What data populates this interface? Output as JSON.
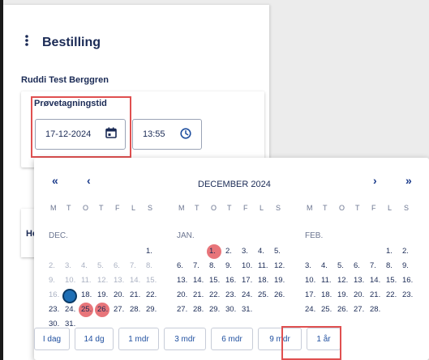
{
  "header": {
    "menu_icon": "more-vert",
    "title": "Bestilling"
  },
  "patient_name": "Ruddi Test Berggren",
  "sample": {
    "label": "Prøvetagningstid",
    "date_value": "17-12-2024",
    "time_value": "13:55",
    "date_icon": "calendar-icon",
    "time_icon": "clock-icon"
  },
  "second_card_label": "He",
  "calendar": {
    "nav": {
      "prev_year": "«",
      "prev_month": "‹",
      "next_month": "›",
      "next_year": "»"
    },
    "title": "DECEMBER 2024",
    "weekdays": [
      "M",
      "T",
      "O",
      "T",
      "F",
      "L",
      "S"
    ],
    "months": [
      {
        "name": "DEC.",
        "rows": [
          [
            [
              "",
              "",
              ""
            ],
            [
              "",
              "",
              ""
            ],
            [
              "",
              "",
              ""
            ],
            [
              "",
              "",
              ""
            ],
            [
              "",
              "",
              ""
            ],
            [
              "",
              "",
              ""
            ],
            [
              "1.",
              "",
              ""
            ]
          ],
          [
            [
              "2.",
              "m",
              ""
            ],
            [
              "3.",
              "m",
              ""
            ],
            [
              "4.",
              "m",
              ""
            ],
            [
              "5.",
              "m",
              ""
            ],
            [
              "6.",
              "m",
              ""
            ],
            [
              "7.",
              "m",
              ""
            ],
            [
              "8.",
              "m",
              ""
            ]
          ],
          [
            [
              "9.",
              "m",
              ""
            ],
            [
              "10.",
              "m",
              ""
            ],
            [
              "11.",
              "m",
              ""
            ],
            [
              "12.",
              "m",
              ""
            ],
            [
              "13.",
              "m",
              ""
            ],
            [
              "14.",
              "m",
              ""
            ],
            [
              "15.",
              "m",
              ""
            ]
          ],
          [
            [
              "16.",
              "m",
              ""
            ],
            [
              "17.",
              "",
              "today"
            ],
            [
              "18.",
              "",
              ""
            ],
            [
              "19.",
              "",
              ""
            ],
            [
              "20.",
              "",
              ""
            ],
            [
              "21.",
              "",
              ""
            ],
            [
              "22.",
              "",
              ""
            ]
          ],
          [
            [
              "23.",
              "",
              ""
            ],
            [
              "24.",
              "",
              ""
            ],
            [
              "25.",
              "",
              "hl"
            ],
            [
              "26.",
              "",
              "hl"
            ],
            [
              "27.",
              "",
              ""
            ],
            [
              "28.",
              "",
              ""
            ],
            [
              "29.",
              "",
              ""
            ]
          ],
          [
            [
              "30.",
              "",
              ""
            ],
            [
              "31.",
              "",
              ""
            ],
            [
              "",
              "",
              ""
            ],
            [
              "",
              "",
              ""
            ],
            [
              "",
              "",
              ""
            ],
            [
              "",
              "",
              ""
            ],
            [
              "",
              "",
              ""
            ]
          ]
        ]
      },
      {
        "name": "JAN.",
        "rows": [
          [
            [
              "",
              "",
              ""
            ],
            [
              "",
              "",
              ""
            ],
            [
              "1.",
              "",
              "hl"
            ],
            [
              "2.",
              "",
              ""
            ],
            [
              "3.",
              "",
              ""
            ],
            [
              "4.",
              "",
              ""
            ],
            [
              "5.",
              "",
              ""
            ]
          ],
          [
            [
              "6.",
              "",
              ""
            ],
            [
              "7.",
              "",
              ""
            ],
            [
              "8.",
              "",
              ""
            ],
            [
              "9.",
              "",
              ""
            ],
            [
              "10.",
              "",
              ""
            ],
            [
              "11.",
              "",
              ""
            ],
            [
              "12.",
              "",
              ""
            ]
          ],
          [
            [
              "13.",
              "",
              ""
            ],
            [
              "14.",
              "",
              ""
            ],
            [
              "15.",
              "",
              ""
            ],
            [
              "16.",
              "",
              ""
            ],
            [
              "17.",
              "",
              ""
            ],
            [
              "18.",
              "",
              ""
            ],
            [
              "19.",
              "",
              ""
            ]
          ],
          [
            [
              "20.",
              "",
              ""
            ],
            [
              "21.",
              "",
              ""
            ],
            [
              "22.",
              "",
              ""
            ],
            [
              "23.",
              "",
              ""
            ],
            [
              "24.",
              "",
              ""
            ],
            [
              "25.",
              "",
              ""
            ],
            [
              "26.",
              "",
              ""
            ]
          ],
          [
            [
              "27.",
              "",
              ""
            ],
            [
              "28.",
              "",
              ""
            ],
            [
              "29.",
              "",
              ""
            ],
            [
              "30.",
              "",
              ""
            ],
            [
              "31.",
              "",
              ""
            ],
            [
              "",
              "",
              ""
            ],
            [
              "",
              "",
              ""
            ]
          ]
        ]
      },
      {
        "name": "FEB.",
        "rows": [
          [
            [
              "",
              "",
              ""
            ],
            [
              "",
              "",
              ""
            ],
            [
              "",
              "",
              ""
            ],
            [
              "",
              "",
              ""
            ],
            [
              "",
              "",
              ""
            ],
            [
              "1.",
              "",
              ""
            ],
            [
              "2.",
              "",
              ""
            ]
          ],
          [
            [
              "3.",
              "",
              ""
            ],
            [
              "4.",
              "",
              ""
            ],
            [
              "5.",
              "",
              ""
            ],
            [
              "6.",
              "",
              ""
            ],
            [
              "7.",
              "",
              ""
            ],
            [
              "8.",
              "",
              ""
            ],
            [
              "9.",
              "",
              ""
            ]
          ],
          [
            [
              "10.",
              "",
              ""
            ],
            [
              "11.",
              "",
              ""
            ],
            [
              "12.",
              "",
              ""
            ],
            [
              "13.",
              "",
              ""
            ],
            [
              "14.",
              "",
              ""
            ],
            [
              "15.",
              "",
              ""
            ],
            [
              "16.",
              "",
              ""
            ]
          ],
          [
            [
              "17.",
              "",
              ""
            ],
            [
              "18.",
              "",
              ""
            ],
            [
              "19.",
              "",
              ""
            ],
            [
              "20.",
              "",
              ""
            ],
            [
              "21.",
              "",
              ""
            ],
            [
              "22.",
              "",
              ""
            ],
            [
              "23.",
              "",
              ""
            ]
          ],
          [
            [
              "24.",
              "",
              ""
            ],
            [
              "25.",
              "",
              ""
            ],
            [
              "26.",
              "",
              ""
            ],
            [
              "27.",
              "",
              ""
            ],
            [
              "28.",
              "",
              ""
            ],
            [
              "",
              "",
              ""
            ],
            [
              "",
              "",
              ""
            ]
          ]
        ]
      }
    ],
    "quick_buttons": [
      "I dag",
      "14 dg",
      "1 mdr",
      "3 mdr",
      "6 mdr",
      "9 mdr",
      "1 år"
    ]
  },
  "colors": {
    "accent": "#1f4f9f",
    "highlight": "#e8757a",
    "today": "#1f6fb5",
    "annotation_red": "#e05050"
  }
}
